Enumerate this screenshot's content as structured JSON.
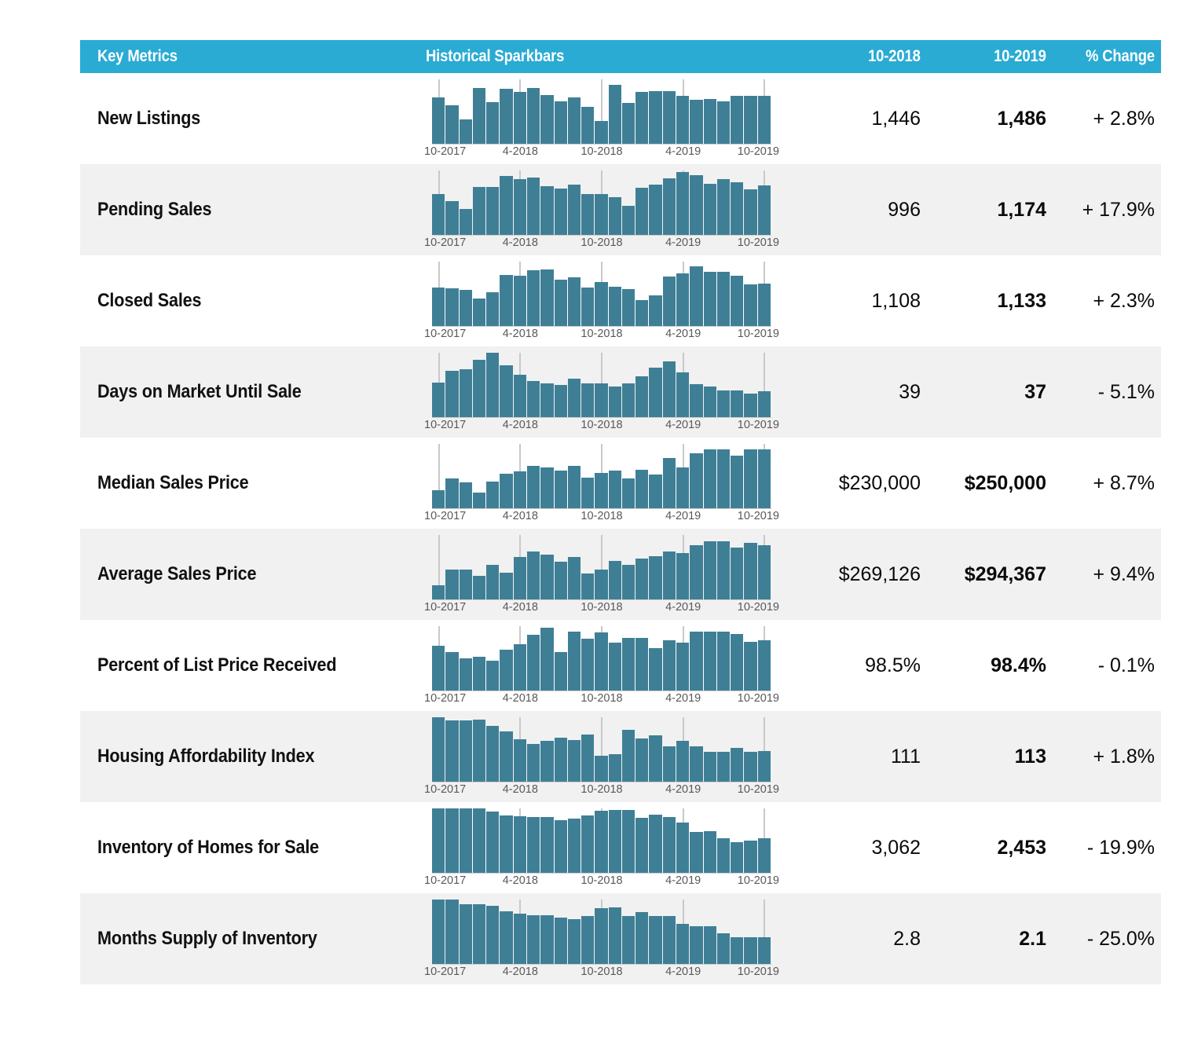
{
  "header": {
    "metric_col": "Key Metrics",
    "spark_col": "Historical Sparkbars",
    "prior_col": "10-2018",
    "current_col": "10-2019",
    "change_col": "% Change",
    "background_color": "#29ABD3",
    "text_color": "#FFFFFF"
  },
  "style": {
    "bar_color": "#3F7F96",
    "alt_row_color": "#F1F1F1",
    "row_color": "#FFFFFF"
  },
  "axis_tick_labels": [
    "10-2017",
    "4-2018",
    "10-2018",
    "4-2019",
    "10-2019"
  ],
  "chart_data": {
    "type": "bar",
    "title": "Key Metrics — Historical Sparkbars",
    "xlabel": "",
    "ylabel": "",
    "grid": false,
    "legend": "none",
    "x": [
      "10-2017",
      "11-2017",
      "12-2017",
      "1-2018",
      "2-2018",
      "3-2018",
      "4-2018",
      "5-2018",
      "6-2018",
      "7-2018",
      "8-2018",
      "9-2018",
      "10-2018",
      "11-2018",
      "12-2018",
      "1-2019",
      "2-2019",
      "3-2019",
      "4-2019",
      "5-2019",
      "6-2019",
      "7-2019",
      "8-2019",
      "9-2019",
      "10-2019"
    ],
    "tick_positions": [
      0,
      6,
      12,
      18,
      24
    ],
    "series": [
      {
        "name": "New Listings",
        "values": [
          1446,
          1220,
          840,
          1600,
          1330,
          1590,
          1520,
          1600,
          1450,
          1320,
          1390,
          1130,
          790,
          1660,
          1300,
          1530,
          1540,
          1540,
          1450,
          1370,
          1390,
          1340,
          1486,
          1486,
          1486
        ],
        "display": [
          0.72,
          0.6,
          0.38,
          0.86,
          0.65,
          0.85,
          0.8,
          0.86,
          0.76,
          0.66,
          0.72,
          0.57,
          0.35,
          0.92,
          0.63,
          0.81,
          0.82,
          0.82,
          0.74,
          0.68,
          0.7,
          0.66,
          0.74,
          0.74,
          0.74
        ]
      },
      {
        "name": "Pending Sales",
        "values": [
          996,
          880,
          770,
          1040,
          1040,
          1230,
          1160,
          1200,
          1050,
          1010,
          1070,
          930,
          930,
          880,
          740,
          1030,
          1080,
          1210,
          1300,
          1250,
          1090,
          1170,
          1130,
          1010,
          1174
        ],
        "display": [
          0.63,
          0.52,
          0.4,
          0.74,
          0.74,
          0.92,
          0.86,
          0.89,
          0.76,
          0.72,
          0.78,
          0.64,
          0.64,
          0.58,
          0.45,
          0.73,
          0.78,
          0.88,
          0.98,
          0.93,
          0.79,
          0.86,
          0.82,
          0.71,
          0.77
        ]
      },
      {
        "name": "Closed Sales",
        "values": [
          1108,
          1100,
          1070,
          930,
          1040,
          1260,
          1250,
          1320,
          1340,
          1190,
          1230,
          1080,
          1150,
          1090,
          1050,
          900,
          960,
          1240,
          1280,
          1390,
          1290,
          1290,
          1240,
          1120,
          1133
        ],
        "display": [
          0.6,
          0.58,
          0.56,
          0.43,
          0.53,
          0.79,
          0.78,
          0.86,
          0.88,
          0.72,
          0.76,
          0.6,
          0.68,
          0.61,
          0.57,
          0.4,
          0.47,
          0.77,
          0.82,
          0.93,
          0.84,
          0.84,
          0.78,
          0.65,
          0.66
        ]
      },
      {
        "name": "Days on Market Until Sale",
        "values": [
          39,
          45,
          46,
          54,
          58,
          48,
          43,
          39,
          38,
          38,
          40,
          38,
          38,
          37,
          38,
          42,
          46,
          50,
          43,
          37,
          36,
          35,
          34,
          32,
          37
        ],
        "display": [
          0.54,
          0.72,
          0.74,
          0.89,
          1.0,
          0.8,
          0.66,
          0.56,
          0.52,
          0.5,
          0.6,
          0.52,
          0.53,
          0.48,
          0.52,
          0.64,
          0.77,
          0.87,
          0.7,
          0.51,
          0.48,
          0.42,
          0.42,
          0.36,
          0.4
        ]
      },
      {
        "name": "Median Sales Price",
        "values": [
          230000,
          239000,
          234000,
          227000,
          236000,
          245000,
          248000,
          255000,
          253000,
          250000,
          255000,
          241000,
          247000,
          250000,
          240000,
          250000,
          246000,
          263000,
          252000,
          266000,
          272000,
          272000,
          265000,
          272000,
          250000
        ],
        "display": [
          0.28,
          0.46,
          0.4,
          0.25,
          0.42,
          0.54,
          0.57,
          0.66,
          0.63,
          0.59,
          0.66,
          0.48,
          0.55,
          0.59,
          0.46,
          0.6,
          0.52,
          0.78,
          0.63,
          0.85,
          0.92,
          0.92,
          0.82,
          0.92,
          0.92
        ]
      },
      {
        "name": "Average Sales Price",
        "values": [
          269126,
          279000,
          279000,
          274000,
          283000,
          275000,
          289000,
          293000,
          291000,
          285000,
          289000,
          274000,
          277000,
          285000,
          281000,
          288000,
          290000,
          295000,
          293000,
          303000,
          306000,
          306000,
          300000,
          305000,
          294367
        ],
        "display": [
          0.22,
          0.46,
          0.46,
          0.36,
          0.54,
          0.42,
          0.66,
          0.74,
          0.7,
          0.58,
          0.66,
          0.4,
          0.46,
          0.6,
          0.54,
          0.64,
          0.67,
          0.74,
          0.72,
          0.84,
          0.9,
          0.9,
          0.8,
          0.88,
          0.84
        ]
      },
      {
        "name": "Percent of List Price Received",
        "values": [
          98.5,
          98.1,
          97.8,
          97.9,
          97.6,
          98.3,
          98.6,
          99.1,
          99.5,
          98.4,
          99.4,
          99.0,
          99.3,
          98.8,
          99.1,
          99.1,
          98.5,
          98.9,
          98.8,
          99.4,
          99.4,
          99.4,
          99.3,
          98.9,
          98.4
        ],
        "display": [
          0.7,
          0.6,
          0.5,
          0.53,
          0.46,
          0.64,
          0.72,
          0.86,
          0.98,
          0.6,
          0.92,
          0.8,
          0.9,
          0.74,
          0.82,
          0.82,
          0.66,
          0.78,
          0.74,
          0.92,
          0.92,
          0.92,
          0.88,
          0.76,
          0.78
        ]
      },
      {
        "name": "Housing Affordability Index",
        "values": [
          111,
          124,
          124,
          125,
          119,
          114,
          108,
          105,
          106,
          108,
          107,
          112,
          97,
          98,
          116,
          108,
          112,
          103,
          107,
          103,
          99,
          99,
          102,
          99,
          113
        ],
        "display": [
          1.0,
          0.95,
          0.95,
          0.96,
          0.86,
          0.78,
          0.66,
          0.58,
          0.63,
          0.68,
          0.65,
          0.73,
          0.4,
          0.43,
          0.8,
          0.67,
          0.72,
          0.55,
          0.64,
          0.55,
          0.46,
          0.46,
          0.52,
          0.46,
          0.47
        ]
      },
      {
        "name": "Inventory of Homes for Sale",
        "values": [
          3062,
          3100,
          3100,
          3100,
          3010,
          2920,
          2900,
          2880,
          2880,
          2830,
          2860,
          2920,
          3000,
          3000,
          2870,
          2930,
          2900,
          2880,
          2700,
          2520,
          2540,
          2380,
          2330,
          2350,
          2453
        ],
        "display": [
          1.0,
          1.0,
          1.0,
          1.0,
          0.95,
          0.89,
          0.88,
          0.86,
          0.86,
          0.82,
          0.84,
          0.89,
          0.96,
          0.98,
          0.98,
          0.85,
          0.9,
          0.86,
          0.78,
          0.63,
          0.65,
          0.54,
          0.48,
          0.5,
          0.54
        ]
      },
      {
        "name": "Months Supply of Inventory",
        "values": [
          2.8,
          2.9,
          2.9,
          2.8,
          2.8,
          2.7,
          2.6,
          2.6,
          2.6,
          2.5,
          2.5,
          2.6,
          2.7,
          2.7,
          2.6,
          2.6,
          2.6,
          2.5,
          2.4,
          2.3,
          2.3,
          2.2,
          2.1,
          2.1,
          2.1
        ],
        "display": [
          1.0,
          1.0,
          0.93,
          0.93,
          0.9,
          0.82,
          0.78,
          0.76,
          0.76,
          0.72,
          0.7,
          0.75,
          0.86,
          0.88,
          0.74,
          0.8,
          0.75,
          0.74,
          0.62,
          0.58,
          0.58,
          0.47,
          0.42,
          0.42,
          0.42
        ]
      }
    ]
  },
  "rows": [
    {
      "metric": "New Listings",
      "prior": "1,446",
      "current": "1,486",
      "change": "+ 2.8%"
    },
    {
      "metric": "Pending Sales",
      "prior": "996",
      "current": "1,174",
      "change": "+ 17.9%"
    },
    {
      "metric": "Closed Sales",
      "prior": "1,108",
      "current": "1,133",
      "change": "+ 2.3%"
    },
    {
      "metric": "Days on Market Until Sale",
      "prior": "39",
      "current": "37",
      "change": "- 5.1%"
    },
    {
      "metric": "Median Sales Price",
      "prior": "$230,000",
      "current": "$250,000",
      "change": "+ 8.7%"
    },
    {
      "metric": "Average Sales Price",
      "prior": "$269,126",
      "current": "$294,367",
      "change": "+ 9.4%"
    },
    {
      "metric": "Percent of List Price Received",
      "prior": "98.5%",
      "current": "98.4%",
      "change": "- 0.1%"
    },
    {
      "metric": "Housing Affordability Index",
      "prior": "111",
      "current": "113",
      "change": "+ 1.8%"
    },
    {
      "metric": "Inventory of Homes for Sale",
      "prior": "3,062",
      "current": "2,453",
      "change": "- 19.9%"
    },
    {
      "metric": "Months Supply of Inventory",
      "prior": "2.8",
      "current": "2.1",
      "change": "- 25.0%"
    }
  ]
}
